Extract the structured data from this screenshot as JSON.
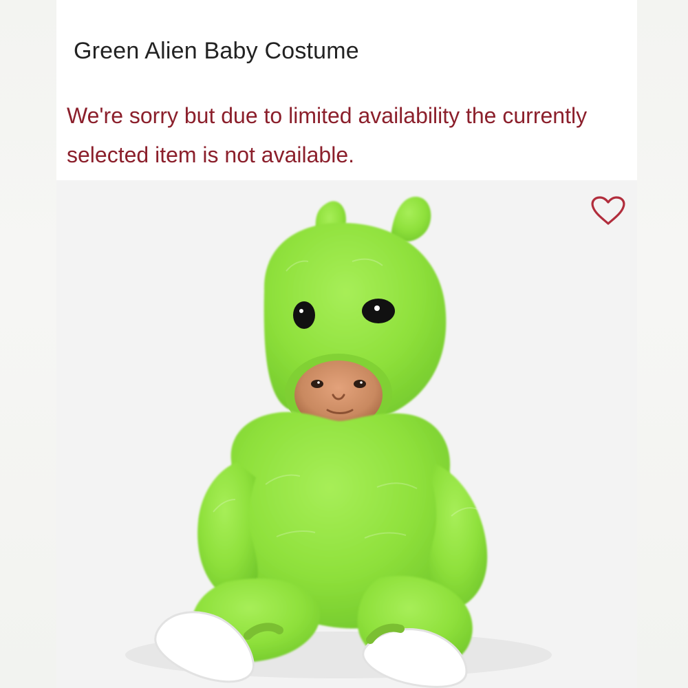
{
  "product": {
    "title": "Green Alien Baby Costume",
    "availability_message": "We're sorry but due to limited availability the currently selected item is not available."
  },
  "icons": {
    "favorite": "heart-outline-icon"
  },
  "colors": {
    "title": "#222222",
    "availability_message": "#8b1f2b",
    "favorite_icon": "#b12d3c",
    "costume_green": "#8ee03b"
  }
}
